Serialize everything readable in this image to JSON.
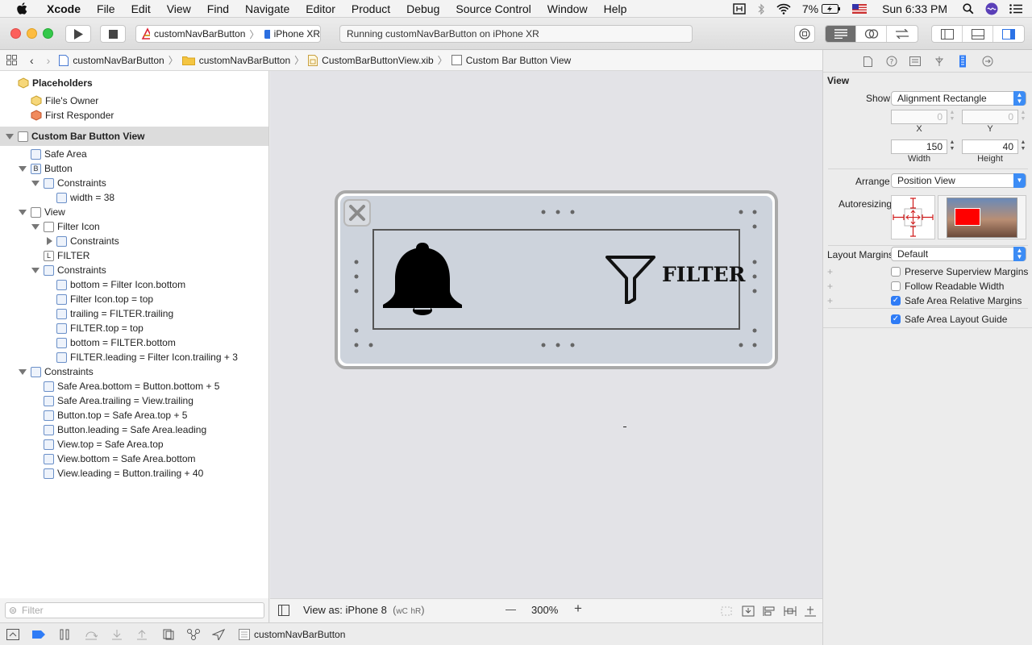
{
  "menubar": {
    "apple": "",
    "items": [
      "Xcode",
      "File",
      "Edit",
      "View",
      "Find",
      "Navigate",
      "Editor",
      "Product",
      "Debug",
      "Source Control",
      "Window",
      "Help"
    ],
    "battery": "7%",
    "clock": "Sun 6:33 PM"
  },
  "toolbar": {
    "scheme": "customNavBarButton",
    "device": "iPhone XR",
    "activity": "Running customNavBarButton on iPhone XR"
  },
  "jumpbar": {
    "crumbs": [
      "customNavBarButton",
      "customNavBarButton",
      "CustomBarButtonView.xib",
      "Custom Bar Button View"
    ]
  },
  "outline": {
    "placeholders": "Placeholders",
    "files_owner": "File's Owner",
    "first_responder": "First Responder",
    "root": "Custom Bar Button View",
    "items": [
      {
        "label": "Safe Area",
        "icon": ""
      },
      {
        "label": "Button",
        "icon": "B"
      },
      {
        "label": "Constraints",
        "icon": ""
      },
      {
        "label": "width = 38",
        "icon": ""
      },
      {
        "label": "View",
        "icon": ""
      },
      {
        "label": "Filter Icon",
        "icon": ""
      },
      {
        "label": "Constraints",
        "icon": ""
      },
      {
        "label": "FILTER",
        "icon": "L"
      },
      {
        "label": "Constraints",
        "icon": ""
      },
      {
        "label": "bottom = Filter Icon.bottom",
        "icon": ""
      },
      {
        "label": "Filter Icon.top = top",
        "icon": ""
      },
      {
        "label": "trailing = FILTER.trailing",
        "icon": ""
      },
      {
        "label": "FILTER.top = top",
        "icon": ""
      },
      {
        "label": "bottom = FILTER.bottom",
        "icon": ""
      },
      {
        "label": "FILTER.leading = Filter Icon.trailing + 3",
        "icon": ""
      },
      {
        "label": "Constraints",
        "icon": ""
      },
      {
        "label": "Safe Area.bottom = Button.bottom + 5",
        "icon": ""
      },
      {
        "label": "Safe Area.trailing = View.trailing",
        "icon": ""
      },
      {
        "label": "Button.top = Safe Area.top + 5",
        "icon": ""
      },
      {
        "label": "Button.leading = Safe Area.leading",
        "icon": ""
      },
      {
        "label": "View.top = Safe Area.top",
        "icon": ""
      },
      {
        "label": "View.bottom = Safe Area.bottom",
        "icon": ""
      },
      {
        "label": "View.leading = Button.trailing + 40",
        "icon": ""
      }
    ],
    "filter_placeholder": "Filter"
  },
  "canvas": {
    "filter_text": "FILTER",
    "view_as": "View as: iPhone 8",
    "size_class_w": "wC",
    "size_class_h": "hR",
    "size_class_close": ")",
    "zoom": "300%",
    "zoom_out": "—",
    "zoom_in": "+"
  },
  "status": {
    "target": "customNavBarButton"
  },
  "inspector": {
    "section": "View",
    "show_label": "Show",
    "show_value": "Alignment Rectangle",
    "x_value": "0",
    "y_value": "0",
    "x_label": "X",
    "y_label": "Y",
    "width_value": "150",
    "height_value": "40",
    "width_label": "Width",
    "height_label": "Height",
    "arrange_label": "Arrange",
    "arrange_value": "Position View",
    "autoresizing_label": "Autoresizing",
    "layout_margins_label": "Layout Margins",
    "layout_margins_value": "Default",
    "options": [
      {
        "label": "Preserve Superview Margins",
        "checked": false
      },
      {
        "label": "Follow Readable Width",
        "checked": false
      },
      {
        "label": "Safe Area Relative Margins",
        "checked": true
      },
      {
        "label": "Safe Area Layout Guide",
        "checked": true
      }
    ]
  },
  "colors": {
    "accent": "#3c8cf5",
    "canvas_bg": "#e3e3e7",
    "view_bg": "#cdd3dc",
    "autoresize_red": "#ff0000"
  }
}
